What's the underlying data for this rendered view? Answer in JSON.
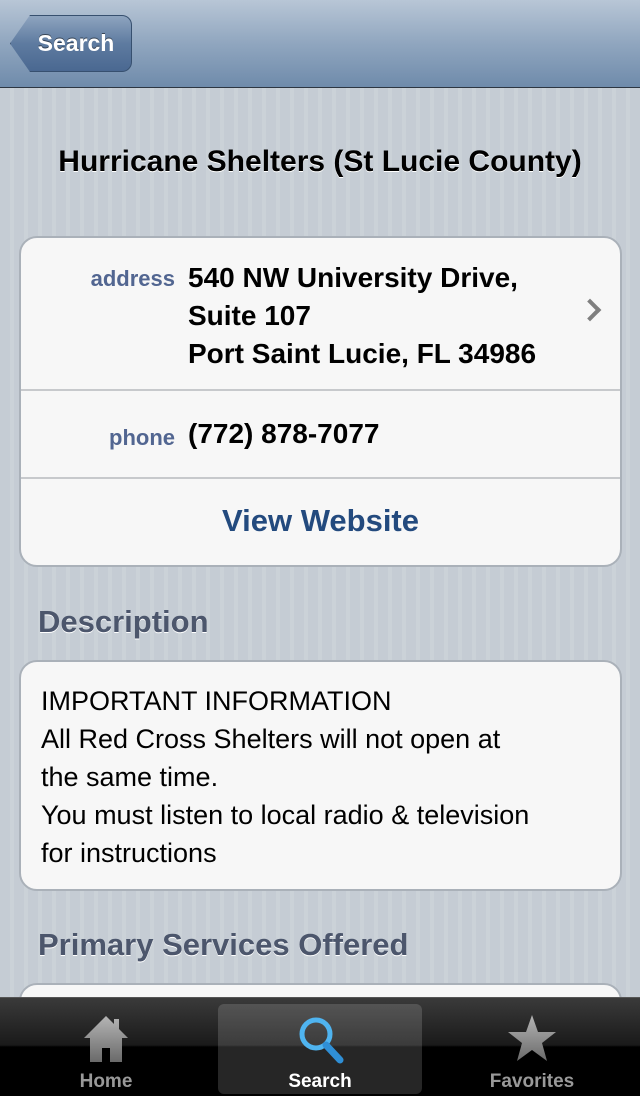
{
  "navbar": {
    "back_label": "Search"
  },
  "page": {
    "title": "Hurricane Shelters (St Lucie County)"
  },
  "contact": {
    "address_label": "address",
    "address_lines": [
      "540 NW University Drive,",
      "Suite 107",
      "Port Saint Lucie, FL 34986"
    ],
    "phone_label": "phone",
    "phone": "(772) 878-7077",
    "website_label": "View Website"
  },
  "description": {
    "header": "Description",
    "lines": [
      "IMPORTANT INFORMATION",
      "All Red Cross Shelters will not open at",
      "the same time.",
      "You must listen to local radio & television",
      "for instructions"
    ]
  },
  "services": {
    "header": "Primary Services Offered"
  },
  "tabbar": {
    "tabs": [
      {
        "label": "Home",
        "icon": "home-icon"
      },
      {
        "label": "Search",
        "icon": "search-icon",
        "selected": true
      },
      {
        "label": "Favorites",
        "icon": "star-icon"
      }
    ]
  }
}
